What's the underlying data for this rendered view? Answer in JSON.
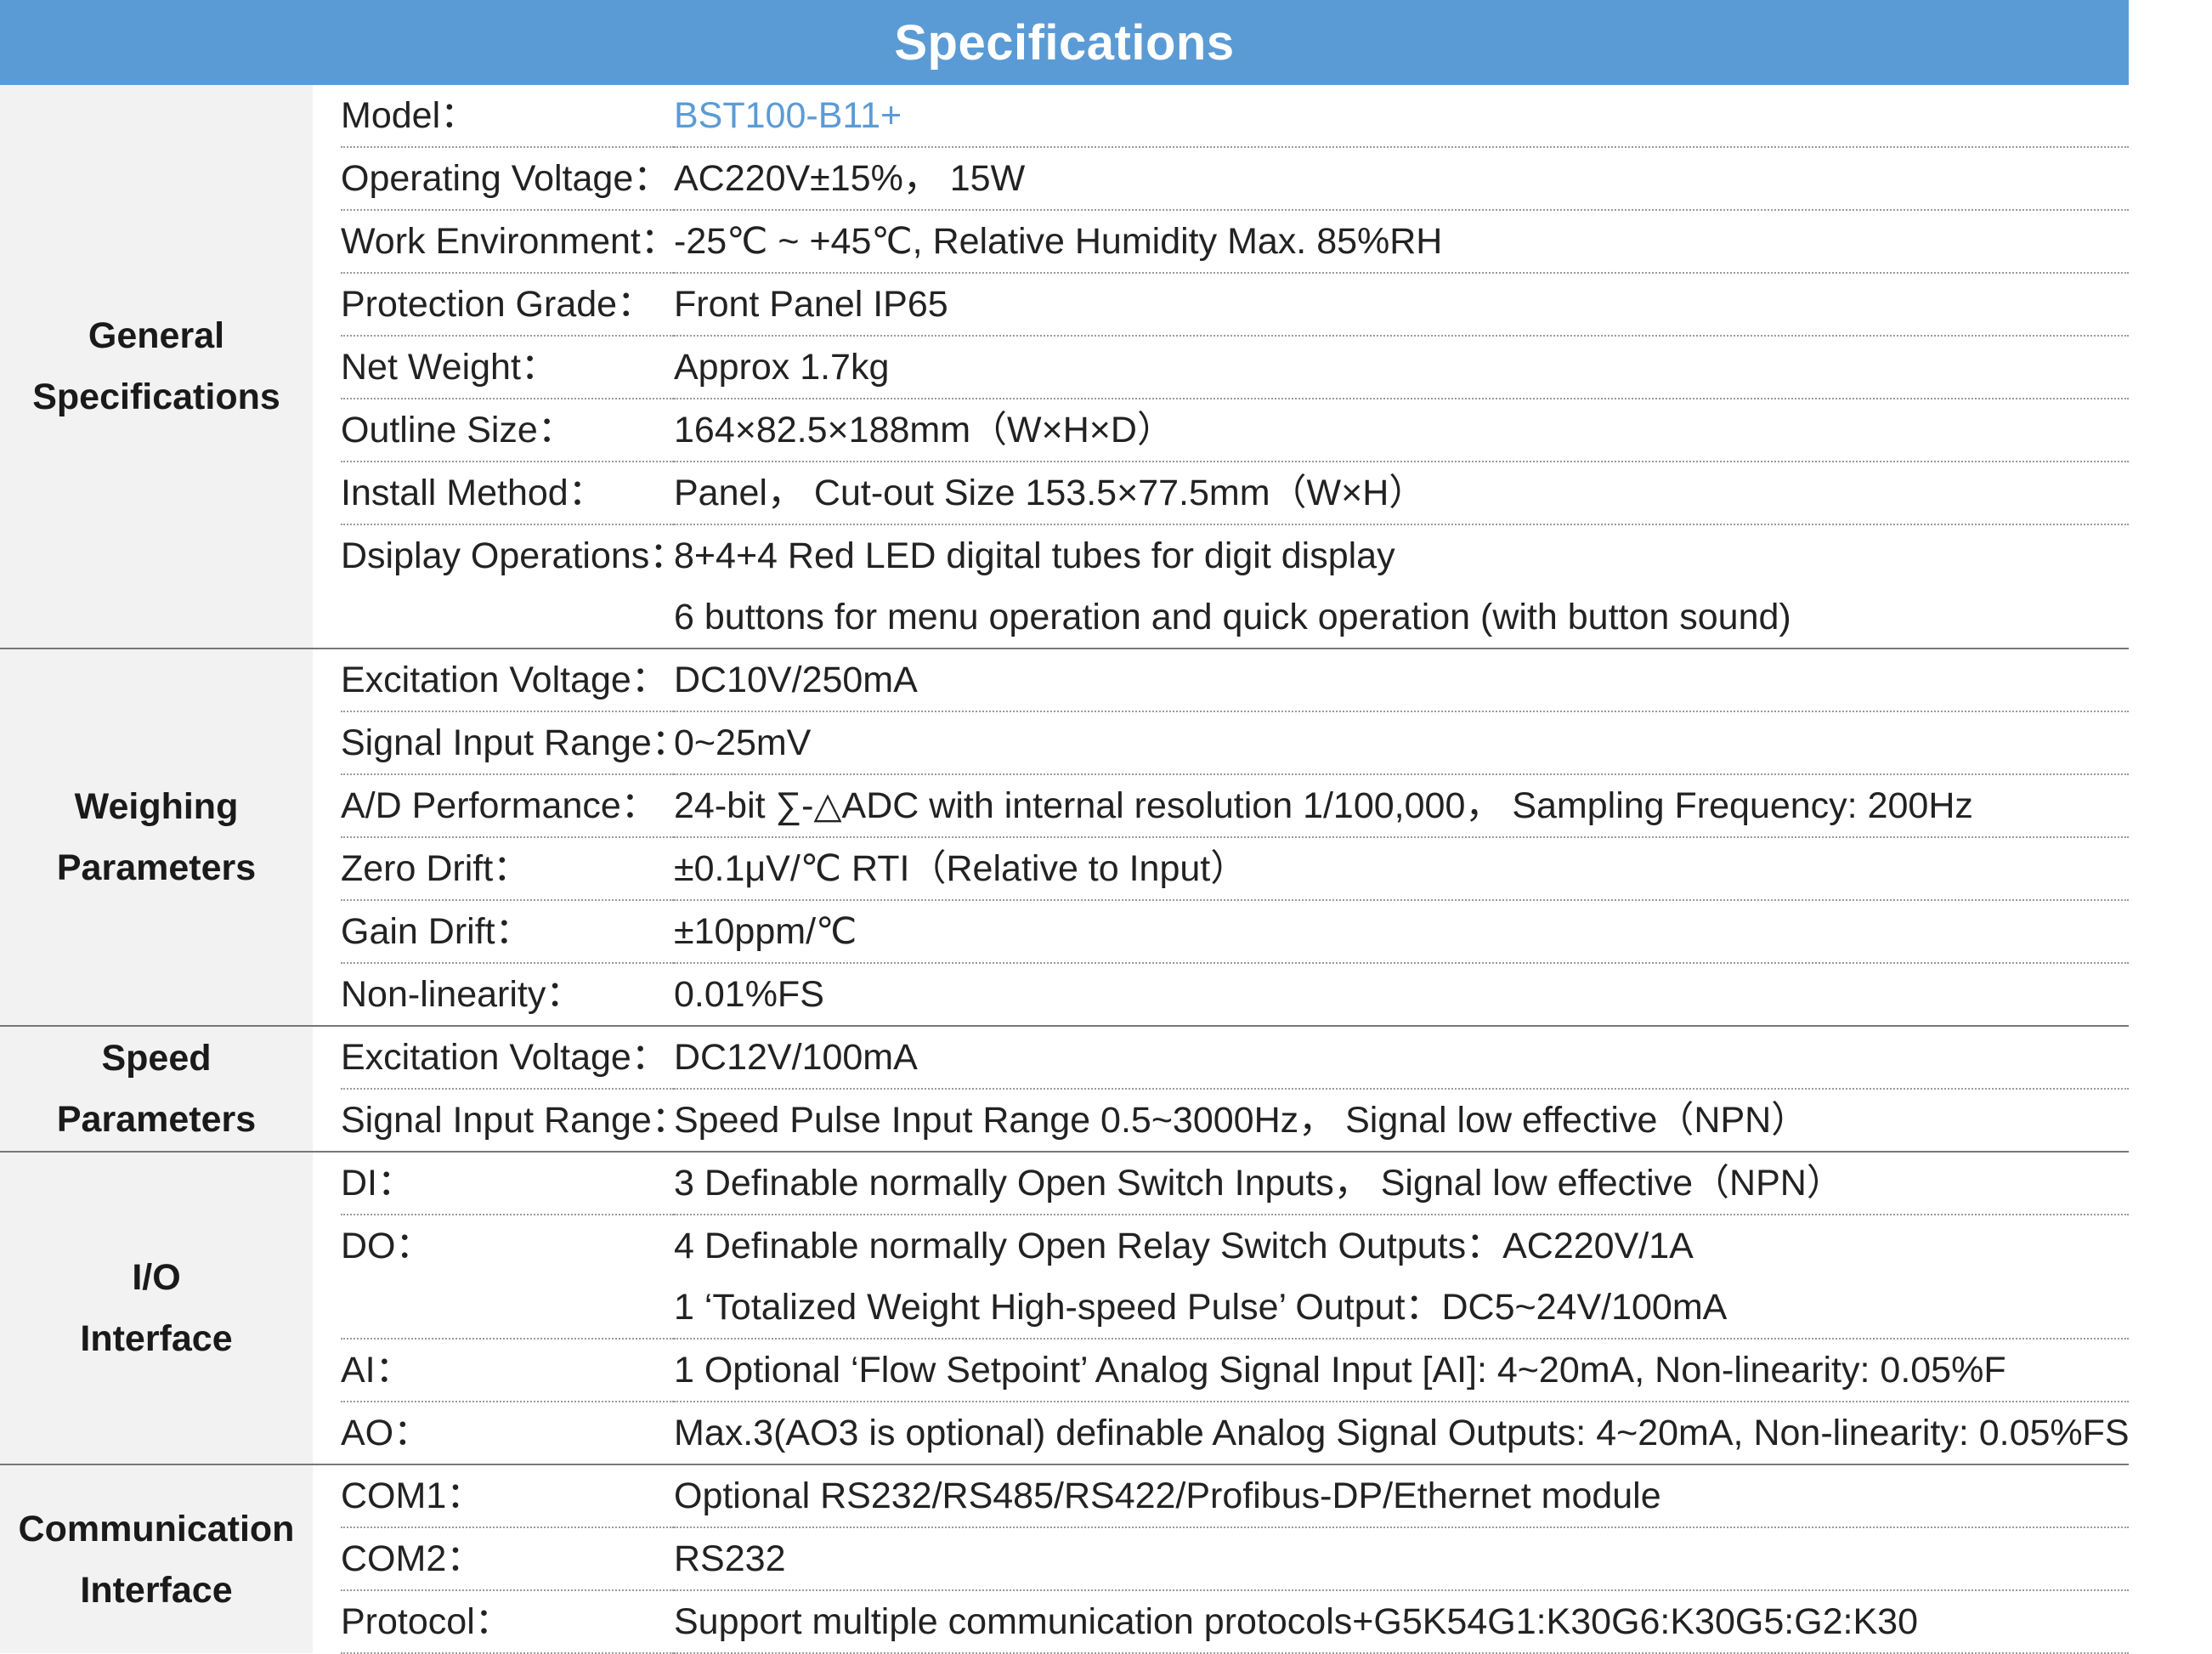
{
  "title": "Specifications",
  "groups": [
    {
      "name_lines": [
        "General",
        "Specifications"
      ],
      "rows": [
        {
          "label": "Model：",
          "values": [
            "BST100-B11+"
          ]
        },
        {
          "label": "Operating Voltage：",
          "values": [
            "AC220V±15%， 15W"
          ]
        },
        {
          "label": "Work Environment：",
          "values": [
            "-25℃ ~ +45℃, Relative Humidity Max. 85%RH"
          ]
        },
        {
          "label": "Protection Grade：",
          "values": [
            "Front Panel  IP65"
          ]
        },
        {
          "label": "Net Weight：",
          "values": [
            "Approx  1.7kg"
          ]
        },
        {
          "label": "Outline Size：",
          "values": [
            "164×82.5×188mm（W×H×D）"
          ]
        },
        {
          "label": "Install Method：",
          "values": [
            "Panel，  Cut-out Size  153.5×77.5mm（W×H）"
          ]
        },
        {
          "label": "Dsiplay Operations：",
          "values": [
            "8+4+4 Red LED digital tubes for digit display",
            "6 buttons for menu operation and quick operation (with button sound)"
          ]
        }
      ]
    },
    {
      "name_lines": [
        "Weighing",
        "Parameters"
      ],
      "rows": [
        {
          "label": "Excitation Voltage：",
          "values": [
            "DC10V/250mA"
          ]
        },
        {
          "label": "Signal Input Range：",
          "values": [
            "0~25mV"
          ]
        },
        {
          "label": "A/D Performance：",
          "values": [
            "24-bit ∑-△ADC with internal resolution 1/100,000， Sampling Frequency: 200Hz"
          ]
        },
        {
          "label": "Zero Drift：",
          "values": [
            "±0.1μV/℃ RTI（Relative to Input）"
          ]
        },
        {
          "label": "Gain Drift：",
          "values": [
            "±10ppm/℃"
          ]
        },
        {
          "label": "Non-linearity：",
          "values": [
            "0.01%FS"
          ]
        }
      ]
    },
    {
      "name_lines": [
        "Speed",
        "Parameters"
      ],
      "rows": [
        {
          "label": "Excitation Voltage：",
          "values": [
            "DC12V/100mA"
          ]
        },
        {
          "label": "Signal Input Range：",
          "values": [
            "Speed Pulse Input Range  0.5~3000Hz， Signal low effective（NPN）"
          ]
        }
      ]
    },
    {
      "name_lines": [
        "I/O",
        "Interface"
      ],
      "rows": [
        {
          "label": "DI：",
          "values": [
            "3 Definable normally Open Switch Inputs， Signal low effective（NPN）"
          ]
        },
        {
          "label": "DO：",
          "values": [
            "4 Definable normally Open Relay Switch Outputs：AC220V/1A",
            "1 ‘Totalized Weight High-speed Pulse’ Output：DC5~24V/100mA"
          ]
        },
        {
          "label": "AI：",
          "values": [
            "1 Optional ‘Flow Setpoint’ Analog Signal Input [AI]: 4~20mA, Non-linearity: 0.05%F"
          ]
        },
        {
          "label": "AO：",
          "values": [
            "Max.3(AO3 is optional) definable Analog Signal Outputs: 4~20mA, Non-linearity: 0.05%FS"
          ]
        }
      ]
    },
    {
      "name_lines": [
        "Communication",
        "Interface"
      ],
      "rows": [
        {
          "label": "COM1：",
          "values": [
            "Optional RS232/RS485/RS422/Profibus-DP/Ethernet module"
          ]
        },
        {
          "label": "COM2：",
          "values": [
            "RS232"
          ]
        },
        {
          "label": "Protocol：",
          "values": [
            "Support multiple communication protocols+G5K54G1:K30G6:K30G5:G2:K30"
          ]
        }
      ]
    }
  ]
}
